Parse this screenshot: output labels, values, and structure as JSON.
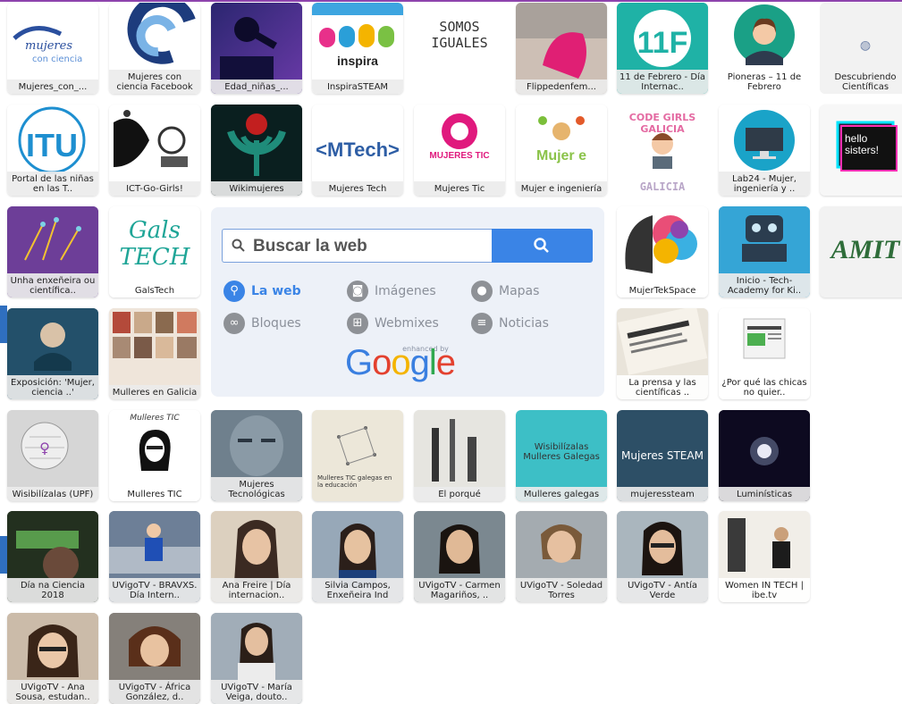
{
  "search": {
    "placeholder": "Buscar la web",
    "options": [
      {
        "label": "La web",
        "icon": "search-icon",
        "active": true
      },
      {
        "label": "Imágenes",
        "icon": "camera-icon"
      },
      {
        "label": "Mapas",
        "icon": "map-pin-icon"
      },
      {
        "label": "Bloques",
        "icon": "link-icon"
      },
      {
        "label": "Webmixes",
        "icon": "globe-grid-icon"
      },
      {
        "label": "Noticias",
        "icon": "list-icon"
      }
    ],
    "enhanced_by": "enhanced by",
    "brand": "Google"
  },
  "tiles": [
    {
      "label": "Mujeres_con_..."
    },
    {
      "label": "Mujeres con ciencia Facebook"
    },
    {
      "label": "Edad_niñas_..."
    },
    {
      "label": "InspiraSTEAM",
      "art": "inspira"
    },
    {
      "label": "",
      "art": "SOMOS IGUALES"
    },
    {
      "label": "Flippedenfem..."
    },
    {
      "label": "11 de Febrero - Día Internac..",
      "art": "11F"
    },
    {
      "label": "Pioneras – 11 de Febrero"
    },
    {
      "label": "Descubriendo Científicas"
    },
    {
      "label": "Portal de las niñas en las T..",
      "art": "ITU"
    },
    {
      "label": "ICT-Go-Girls!"
    },
    {
      "label": "Wikimujeres"
    },
    {
      "label": "Mujeres Tech",
      "art": "<MTech>"
    },
    {
      "label": "Mujeres Tic",
      "art": "MUJERES TIC"
    },
    {
      "label": "Mujer e ingeniería"
    },
    {
      "label": "",
      "art": "CODE GIRLS GALICIA"
    },
    {
      "label": "Lab24 - Mujer, ingeniería y .."
    },
    {
      "label": "",
      "art": "hello sisters!"
    },
    {
      "label": "Unha enxeñeira ou científica.."
    },
    {
      "label": "GalsTech",
      "art": "Gals TECH"
    },
    {
      "label": "MujerTekSpace"
    },
    {
      "label": "Inicio - Tech-Academy for Ki.."
    },
    {
      "label": "",
      "art": "AMIT"
    },
    {
      "label": "Exposición: 'Mujer, ciencia ..'"
    },
    {
      "label": "Mulleres en Galicia"
    },
    {
      "label": "La prensa y las científicas .."
    },
    {
      "label": "¿Por qué las chicas no quier.."
    },
    {
      "label": "Wisibilízalas (UPF)"
    },
    {
      "label": "Mulleres TIC",
      "art": "Mulleres TIC"
    },
    {
      "label": "Mujeres Tecnológicas"
    },
    {
      "label": "",
      "art": "Mulleres TIC galegas en la educación"
    },
    {
      "label": "El porqué"
    },
    {
      "label": "Mulleres galegas",
      "art": "Wisibilízalas Mulleres Galegas"
    },
    {
      "label": "mujeressteam",
      "art": "Mujeres STEAM"
    },
    {
      "label": "Luminísticas"
    },
    {
      "label": "Día na Ciencia 2018"
    },
    {
      "label": "UVigoTV - BRAVXS. Día Intern.."
    },
    {
      "label": "Ana Freire | Día internacion.."
    },
    {
      "label": "Silvia Campos, Enxeñeira Ind"
    },
    {
      "label": "UVigoTV - Carmen Magariños, .."
    },
    {
      "label": "UVigoTV - Soledad Torres"
    },
    {
      "label": "UVigoTV - Antía Verde"
    },
    {
      "label": "Women IN TECH | ibe.tv"
    },
    {
      "label": "UVigoTV - Ana Sousa, estudan.."
    },
    {
      "label": "UVigoTV - África González, d.."
    },
    {
      "label": "UVigoTV - María Veiga, douto.."
    }
  ]
}
